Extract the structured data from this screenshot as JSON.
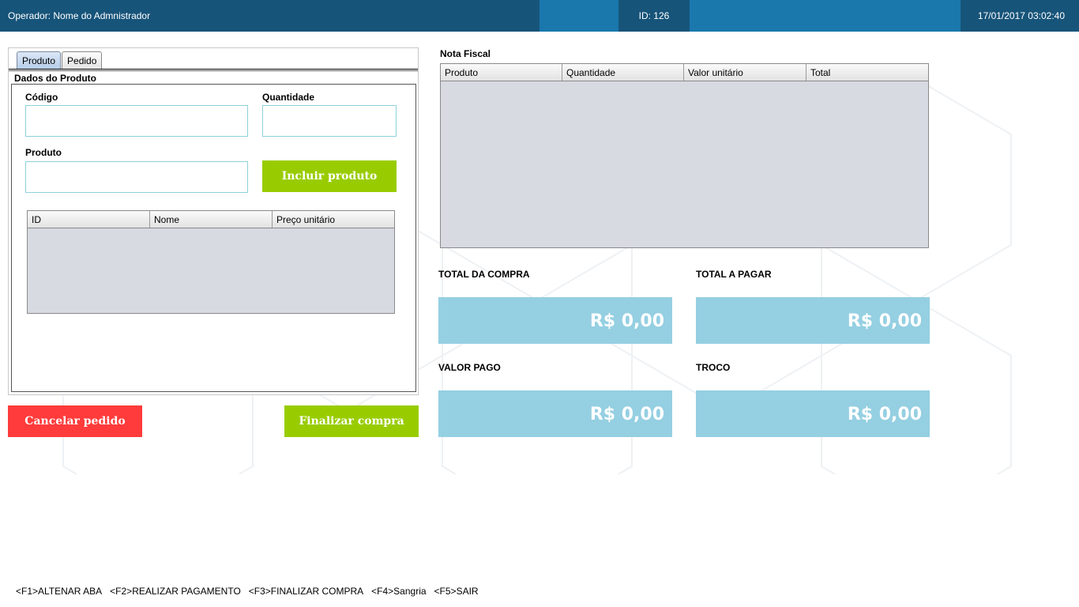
{
  "header": {
    "operator": "Operador: Nome do Admnistrador",
    "id": "ID: 126",
    "datetime": "17/01/2017 03:02:40"
  },
  "tabs": [
    {
      "label": "Produto",
      "active": true
    },
    {
      "label": "Pedido",
      "active": false
    }
  ],
  "produto": {
    "group_title": "Dados do Produto",
    "codigo_label": "Código",
    "codigo_value": "",
    "quantidade_label": "Quantidade",
    "quantidade_value": "",
    "produto_label": "Produto",
    "produto_value": "",
    "incluir_button": "Incluir produto",
    "table": {
      "columns": [
        "ID",
        "Nome",
        "Preço unitário"
      ],
      "rows": []
    }
  },
  "actions": {
    "cancel": "Cancelar pedido",
    "finalize": "Finalizar compra"
  },
  "nota_fiscal": {
    "title": "Nota Fiscal",
    "columns": [
      "Produto",
      "Quantidade",
      "Valor unitário",
      "Total"
    ],
    "rows": []
  },
  "totals": {
    "total_compra_label": "TOTAL DA COMPRA",
    "total_compra_value": "R$ 0,00",
    "total_pagar_label": "TOTAL A PAGAR",
    "total_pagar_value": "R$ 0,00",
    "valor_pago_label": "VALOR PAGO",
    "valor_pago_value": "R$ 0,00",
    "troco_label": "TROCO",
    "troco_value": "R$ 0,00"
  },
  "shortcuts": [
    "<F1>ALTENAR ABA",
    "<F2>REALIZAR PAGAMENTO",
    "<F3>FINALIZAR COMPRA",
    "<F4>Sangria",
    "<F5>SAIR"
  ],
  "colors": {
    "header_dark": "#17547a",
    "header_light": "#1a78ad",
    "green_button": "#99cc00",
    "red_button": "#ff3b3b",
    "money_box": "#95cfe2"
  }
}
